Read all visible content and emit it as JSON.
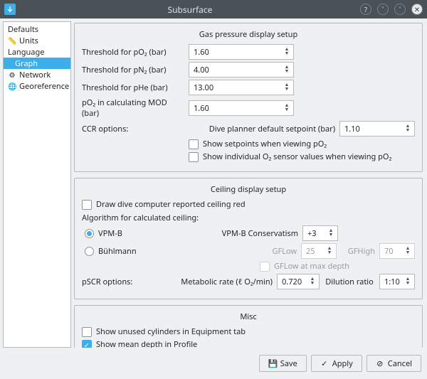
{
  "window": {
    "title": "Subsurface"
  },
  "sidebar": {
    "items": [
      {
        "label": "Defaults",
        "icon": ""
      },
      {
        "label": "Units",
        "icon": "📏"
      },
      {
        "label": "Language",
        "icon": ""
      },
      {
        "label": "Graph",
        "icon": ""
      },
      {
        "label": "Network",
        "icon": "⚙"
      },
      {
        "label": "Georeference",
        "icon": "🌐"
      }
    ]
  },
  "gas": {
    "title": "Gas pressure display setup",
    "po2_label": "Threshold for pO₂ (bar)",
    "po2_value": "1.60",
    "pn2_label": "Threshold for pN₂ (bar)",
    "pn2_value": "4.00",
    "phe_label": "Threshold for pHe (bar)",
    "phe_value": "13.00",
    "po2mod_label": "pO₂ in calculating MOD (bar)",
    "po2mod_value": "1.60",
    "ccr_label": "CCR options:",
    "setpt_label": "Dive planner default setpoint (bar)",
    "setpt_value": "1.10",
    "show_setpoints_label": "Show setpoints when viewing pO₂",
    "show_sensors_label": "Show individual O₂ sensor values when viewing pO₂"
  },
  "ceiling": {
    "title": "Ceiling display setup",
    "draw_red_label": "Draw dive computer reported ceiling red",
    "algo_label": "Algorithm for calculated ceiling:",
    "vpmb_label": "VPM-B",
    "vpmb_cons_label": "VPM-B Conservatism",
    "vpmb_cons_value": "+3",
    "buhl_label": "Bühlmann",
    "gflow_label": "GFLow",
    "gflow_value": "25",
    "gfhigh_label": "GFHigh",
    "gfhigh_value": "70",
    "gflow_maxdepth_label": "GFLow at max depth",
    "pscr_label": "pSCR options:",
    "metabolic_label": "Metabolic rate (ℓ O₂/min)",
    "metabolic_value": "0.720",
    "dilution_label": "Dilution ratio",
    "dilution_value": "1:10"
  },
  "misc": {
    "title": "Misc",
    "unused_cyl_label": "Show unused cylinders in Equipment tab",
    "mean_depth_label": "Show mean depth in Profile"
  },
  "buttons": {
    "save": "Save",
    "apply": "Apply",
    "cancel": "Cancel"
  }
}
